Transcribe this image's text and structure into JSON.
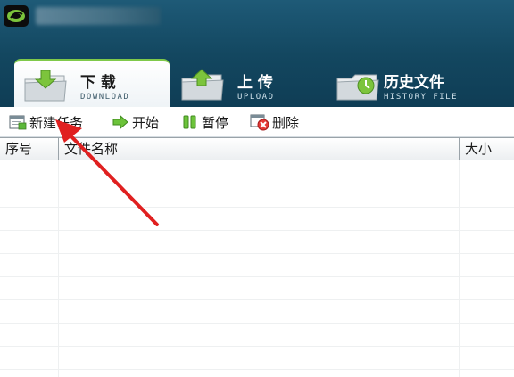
{
  "tabs": [
    {
      "label_cn": "下 载",
      "label_en": "DOWNLOAD",
      "icon": "download-folder-icon",
      "active": true
    },
    {
      "label_cn": "上 传",
      "label_en": "UPLOAD",
      "icon": "upload-folder-icon",
      "active": false
    },
    {
      "label_cn": "历史文件",
      "label_en": "HISTORY FILE",
      "icon": "history-folder-icon",
      "active": false
    }
  ],
  "toolbar": {
    "new_task": "新建任务",
    "start": "开始",
    "pause": "暂停",
    "delete": "删除"
  },
  "table": {
    "columns": [
      "序号",
      "文件名称",
      "大小"
    ],
    "rows": []
  },
  "colors": {
    "titlebar": "#134760",
    "tab_active_accent": "#7fc94a",
    "annotation_arrow": "#e02020"
  }
}
